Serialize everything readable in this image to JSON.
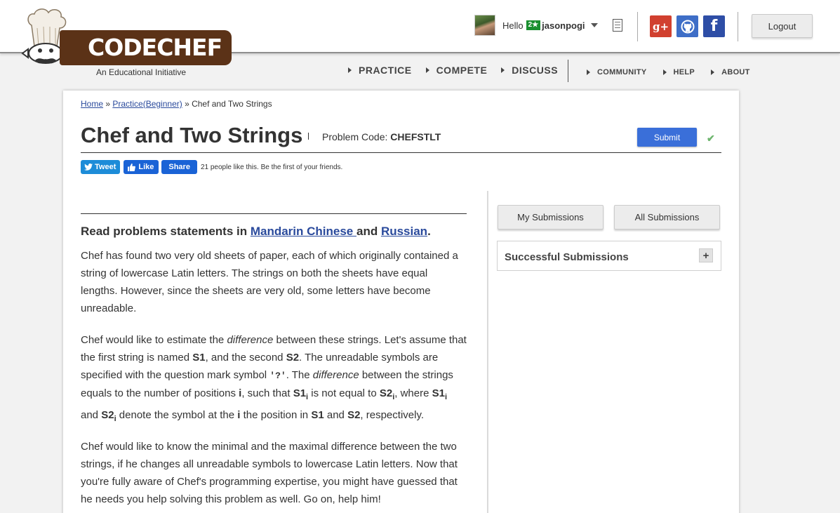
{
  "header": {
    "logo": {
      "name": "CODECHEF",
      "tagline": "An Educational Initiative"
    },
    "user": {
      "greeting": "Hello",
      "rating_badge": "2★",
      "username": "jasonpogi"
    },
    "social": {
      "google": "g+",
      "facebook": "f"
    },
    "logout_label": "Logout"
  },
  "nav": {
    "primary": [
      "PRACTICE",
      "COMPETE",
      "DISCUSS"
    ],
    "secondary": [
      "COMMUNITY",
      "HELP",
      "ABOUT"
    ]
  },
  "breadcrumb": {
    "home": "Home",
    "sep1": " » ",
    "section": "Practice(Beginner)",
    "sep2": " » ",
    "current": "Chef and Two Strings"
  },
  "problem": {
    "title": "Chef and Two Strings",
    "code_label": "Problem Code: ",
    "code": "CHEFSTLT",
    "submit_label": "Submit",
    "check_icon": "✔"
  },
  "share": {
    "tweet": "Tweet",
    "like": "Like",
    "share": "Share",
    "count_text": "21 people like this. Be the first of your friends."
  },
  "statement": {
    "lang_prefix": "Read problems statements in ",
    "lang1": "Mandarin Chinese ",
    "lang_and": "and ",
    "lang2": "Russian",
    "lang_end": ".",
    "p1": "Chef has found two very old sheets of paper, each of which originally contained a string of lowercase Latin letters. The strings on both the sheets have equal lengths. However, since the sheets are very old, some letters have become unreadable.",
    "p2": {
      "a": "Chef would like to estimate the ",
      "diff": "difference",
      "b": " between these strings. Let's assume that the first string is named ",
      "s1": "S1",
      "c": ", and the second ",
      "s2": "S2",
      "d": ". The unreadable symbols are specified with the question mark symbol ",
      "q": "'?'",
      "e": ". The ",
      "f": " between the strings equals to the number of positions ",
      "i": "i",
      "g": ", such that ",
      "h": " is not equal to ",
      "j": ", where ",
      "k": "and ",
      "l": " denote the symbol at the ",
      "m": " the position in ",
      "n": " and ",
      "o": ", respectively."
    },
    "p3": "Chef would like to know the minimal and the maximal difference between the two strings, if he changes all unreadable symbols to lowercase Latin letters. Now that you're fully aware of Chef's programming expertise, you might have guessed that he needs you help solving this problem as well. Go on, help him!"
  },
  "sidebar": {
    "my_submissions": "My Submissions",
    "all_submissions": "All Submissions",
    "successful_title": "Successful Submissions",
    "expand_icon": "+"
  }
}
